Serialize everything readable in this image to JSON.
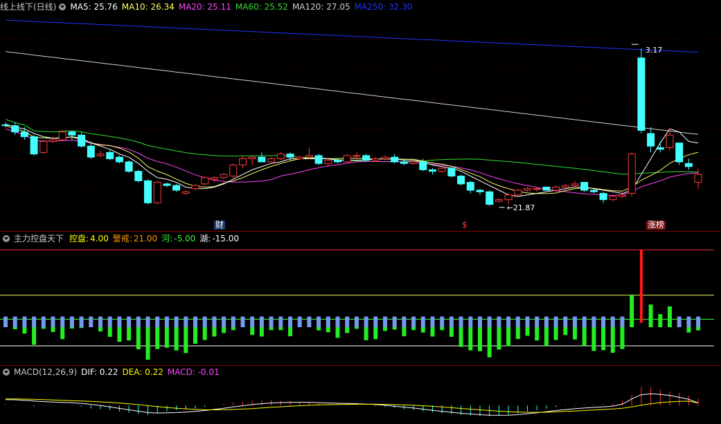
{
  "price_header": {
    "title": "线上线下(日线)",
    "items": [
      {
        "label": "MA5: 25.76",
        "color": "#ffffff"
      },
      {
        "label": "MA10: 26.34",
        "color": "#ffff66"
      },
      {
        "label": "MA20: 25.11",
        "color": "#ff44ff"
      },
      {
        "label": "MA60: 25.52",
        "color": "#33dd33"
      },
      {
        "label": "MA120: 27.05",
        "color": "#d0d0d0"
      },
      {
        "label": "MA250: 32.30",
        "color": "#2233ff"
      }
    ]
  },
  "indicator_header": {
    "title": "主力控盘天下",
    "items": [
      {
        "name": "控盘:",
        "value": "4.00",
        "color": "#ffff00"
      },
      {
        "name": "警戒:",
        "value": "21.00",
        "color": "#ff9900"
      },
      {
        "name": "河:",
        "value": "-5.00",
        "color": "#33ff33"
      },
      {
        "name": "湖:",
        "value": "-15.00",
        "color": "#ffffff"
      }
    ]
  },
  "macd_header": {
    "title": "MACD(12,26,9)",
    "items": [
      {
        "label": "DIF: 0.22",
        "color": "#ffffff"
      },
      {
        "label": "DEA: 0.22",
        "color": "#ffff00"
      },
      {
        "label": "MACD: -0.01",
        "color": "#ff44ff"
      }
    ]
  },
  "markers": {
    "cai": "财",
    "dollar": "$",
    "zhangbang": "涨榜"
  },
  "chart_data": [
    {
      "type": "candlestick",
      "title": "线上线下(日线)",
      "y_range": [
        21.0,
        34.0
      ],
      "annotations": {
        "high": "3.17",
        "low": "21.87"
      },
      "colors": {
        "up": "#ff3b3b",
        "down": "#44ffff"
      },
      "ohlc": [
        [
          26.95,
          27.1,
          26.8,
          26.9
        ],
        [
          26.9,
          27.1,
          26.3,
          26.5
        ],
        [
          26.5,
          26.8,
          26.0,
          26.2
        ],
        [
          26.2,
          26.3,
          25.0,
          25.1
        ],
        [
          25.2,
          26.0,
          25.1,
          25.9
        ],
        [
          25.9,
          26.2,
          25.8,
          26.0
        ],
        [
          26.0,
          26.6,
          25.9,
          26.5
        ],
        [
          26.5,
          26.6,
          26.0,
          26.3
        ],
        [
          26.3,
          26.5,
          25.5,
          25.6
        ],
        [
          25.6,
          25.9,
          24.8,
          24.9
        ],
        [
          25.0,
          25.3,
          24.9,
          25.1
        ],
        [
          25.2,
          25.4,
          24.7,
          24.8
        ],
        [
          24.9,
          25.0,
          24.5,
          24.6
        ],
        [
          24.6,
          24.7,
          23.9,
          24.0
        ],
        [
          24.0,
          24.1,
          23.3,
          23.4
        ],
        [
          23.4,
          23.5,
          21.9,
          22.0
        ],
        [
          22.0,
          23.4,
          21.9,
          23.3
        ],
        [
          23.2,
          23.3,
          23.0,
          23.1
        ],
        [
          23.1,
          23.2,
          22.7,
          22.8
        ],
        [
          22.6,
          22.8,
          22.5,
          22.7
        ],
        [
          22.9,
          23.2,
          22.8,
          23.1
        ],
        [
          23.2,
          23.7,
          23.1,
          23.6
        ],
        [
          23.5,
          23.7,
          23.3,
          23.6
        ],
        [
          23.6,
          23.9,
          23.5,
          23.8
        ],
        [
          23.7,
          24.5,
          23.5,
          24.4
        ],
        [
          24.4,
          25.0,
          24.2,
          24.8
        ],
        [
          24.8,
          25.0,
          24.4,
          24.9
        ],
        [
          24.9,
          25.2,
          24.6,
          24.6
        ],
        [
          24.6,
          24.9,
          24.5,
          24.8
        ],
        [
          24.8,
          25.2,
          24.7,
          25.1
        ],
        [
          25.1,
          25.2,
          24.7,
          24.9
        ],
        [
          24.8,
          25.0,
          24.7,
          24.9
        ],
        [
          24.9,
          25.5,
          24.8,
          25.0
        ],
        [
          25.0,
          25.1,
          24.4,
          24.5
        ],
        [
          24.5,
          24.8,
          24.3,
          24.7
        ],
        [
          24.7,
          24.8,
          24.5,
          24.6
        ],
        [
          24.6,
          25.1,
          24.5,
          25.0
        ],
        [
          25.0,
          25.2,
          24.8,
          25.0
        ],
        [
          25.0,
          25.1,
          24.6,
          24.7
        ],
        [
          24.7,
          24.9,
          24.6,
          24.8
        ],
        [
          24.8,
          25.0,
          24.7,
          24.9
        ],
        [
          24.9,
          25.1,
          24.5,
          24.6
        ],
        [
          24.6,
          24.8,
          24.4,
          24.5
        ],
        [
          24.5,
          24.7,
          24.4,
          24.6
        ],
        [
          24.6,
          24.8,
          24.0,
          24.1
        ],
        [
          24.1,
          24.2,
          23.8,
          24.0
        ],
        [
          24.0,
          24.3,
          23.9,
          24.2
        ],
        [
          24.2,
          24.3,
          23.6,
          23.7
        ],
        [
          23.7,
          23.8,
          23.1,
          23.2
        ],
        [
          23.3,
          23.4,
          22.6,
          22.8
        ],
        [
          22.8,
          22.9,
          22.5,
          22.7
        ],
        [
          22.7,
          22.8,
          21.8,
          21.9
        ],
        [
          22.1,
          22.3,
          22.0,
          22.2
        ],
        [
          22.2,
          22.6,
          21.9,
          22.5
        ],
        [
          22.5,
          22.9,
          22.4,
          22.8
        ],
        [
          22.8,
          23.0,
          22.7,
          22.9
        ],
        [
          22.9,
          23.0,
          22.7,
          22.9
        ],
        [
          23.0,
          23.0,
          22.8,
          22.8
        ],
        [
          22.8,
          23.1,
          22.7,
          23.0
        ],
        [
          23.0,
          23.2,
          22.8,
          23.1
        ],
        [
          23.1,
          23.4,
          23.0,
          23.2
        ],
        [
          23.3,
          23.3,
          22.7,
          22.8
        ],
        [
          22.8,
          22.9,
          22.6,
          22.7
        ],
        [
          22.6,
          22.7,
          22.0,
          22.2
        ],
        [
          22.2,
          22.5,
          22.1,
          22.4
        ],
        [
          22.4,
          22.6,
          22.3,
          22.5
        ],
        [
          22.6,
          25.2,
          22.4,
          25.1
        ],
        [
          31.2,
          31.8,
          26.4,
          26.6
        ],
        [
          26.4,
          26.8,
          25.2,
          25.6
        ],
        [
          25.5,
          25.9,
          25.2,
          25.4
        ],
        [
          25.5,
          26.7,
          25.3,
          26.3
        ],
        [
          25.8,
          25.8,
          24.4,
          24.6
        ],
        [
          24.5,
          24.8,
          24.1,
          24.3
        ],
        [
          23.3,
          24.2,
          22.9,
          23.8
        ]
      ],
      "ma": {
        "MA5": [
          27.0,
          26.8,
          26.7,
          26.4,
          26.2,
          26.1,
          26.1,
          26.2,
          26.1,
          25.8,
          25.6,
          25.4,
          25.1,
          24.9,
          24.5,
          24.0,
          23.6,
          23.5,
          23.3,
          23.0,
          22.9,
          22.9,
          23.0,
          23.2,
          23.5,
          23.8,
          24.1,
          24.3,
          24.5,
          24.6,
          24.8,
          24.8,
          24.8,
          24.8,
          24.8,
          24.7,
          24.7,
          24.7,
          24.7,
          24.8,
          24.8,
          24.8,
          24.7,
          24.7,
          24.6,
          24.4,
          24.3,
          24.2,
          24.0,
          23.7,
          23.4,
          23.1,
          22.8,
          22.5,
          22.4,
          22.5,
          22.6,
          22.7,
          22.8,
          22.9,
          23.0,
          23.0,
          22.9,
          22.8,
          22.7,
          22.6,
          22.8,
          23.8,
          24.8,
          25.8,
          26.7,
          26.5,
          25.9,
          25.8
        ]
      }
    },
    {
      "type": "bar",
      "title": "主力控盘天下",
      "y_range": [
        -22.0,
        26.0
      ],
      "levels": {
        "控盘": 4.0,
        "警戒": 21.0,
        "河": -5.0,
        "湖": -15.0
      },
      "top_values": [
        -4.0,
        -4.0,
        -4.0,
        -4.0,
        -4.0,
        -4.0,
        -4.0,
        -4.0,
        -4.0,
        -4.0,
        -4.0,
        -4.0,
        -4.0,
        -4.0,
        -4.0,
        -4.0,
        -4.0,
        -4.0,
        -4.0,
        -4.0,
        -4.0,
        -4.0,
        -4.0,
        -4.0,
        -4.0,
        -4.0,
        -4.0,
        -4.0,
        -4.0,
        -4.0,
        -4.0,
        -4.0,
        -4.0,
        -4.0,
        -4.0,
        -4.0,
        -4.0,
        -4.0,
        -4.0,
        -4.0,
        -4.0,
        -4.0,
        -4.0,
        -4.0,
        -4.0,
        -4.0,
        -4.0,
        -4.0,
        -4.0,
        -4.0,
        -4.0,
        -4.0,
        -4.0,
        -4.0,
        -4.0,
        -4.0,
        -4.0,
        -4.0,
        -4.0,
        -4.0,
        -4.0,
        -4.0,
        -4.0,
        -4.0,
        -4.0,
        -4.0,
        -4.0,
        -4.0,
        -4.0,
        -4.0,
        -4.0,
        -4.0,
        -4.0,
        -4.0
      ],
      "values": [
        -7.5,
        -8.8,
        -10.4,
        -14.6,
        -8.6,
        -9.8,
        -12.5,
        -8.5,
        -8.3,
        -7.7,
        -9.6,
        -11.6,
        -13.5,
        -13.0,
        -16.3,
        -20.2,
        -16.2,
        -15.7,
        -16.7,
        -17.7,
        -14.2,
        -12.8,
        -11.5,
        -10.2,
        -9.1,
        -8.0,
        -10.9,
        -11.5,
        -9.1,
        -9.1,
        -11.4,
        -7.3,
        -6.8,
        -9.2,
        -9.9,
        -12.0,
        -10.2,
        -8.6,
        -12.9,
        -12.5,
        -9.4,
        -8.9,
        -11.4,
        -9.1,
        -10.0,
        -11.5,
        -9.1,
        -11.6,
        -15.4,
        -16.7,
        -17.0,
        -19.3,
        -16.4,
        -15.1,
        -12.4,
        -11.2,
        -13.0,
        -15.0,
        -12.8,
        -10.9,
        -12.6,
        -15.0,
        -16.9,
        -16.6,
        -17.6,
        -16.2,
        4.0,
        21.0,
        0.5,
        -3.1,
        -0.2,
        -6.0,
        -10.0,
        -9.2
      ]
    },
    {
      "type": "bar",
      "title": "MACD(12,26,9)",
      "y_range": [
        -1.5,
        2.5
      ],
      "values": [
        0.08,
        0.06,
        -0.02,
        -0.08,
        -0.06,
        -0.04,
        0.02,
        -0.04,
        -0.1,
        -0.26,
        -0.32,
        -0.42,
        -0.52,
        -0.62,
        -0.72,
        -0.82,
        -0.62,
        -0.5,
        -0.42,
        -0.34,
        -0.26,
        -0.14,
        0.06,
        0.12,
        0.26,
        0.34,
        0.42,
        0.48,
        0.48,
        0.42,
        0.4,
        0.34,
        0.32,
        0.18,
        0.12,
        0.06,
        0.08,
        0.08,
        -0.02,
        -0.06,
        -0.14,
        -0.22,
        -0.32,
        -0.38,
        -0.5,
        -0.58,
        -0.68,
        -0.74,
        -0.82,
        -0.86,
        -0.92,
        -0.94,
        -0.88,
        -0.8,
        -0.68,
        -0.52,
        -0.42,
        -0.28,
        -0.14,
        -0.04,
        0.06,
        0.08,
        0.1,
        0.12,
        0.18,
        0.42,
        0.92,
        1.62,
        1.6,
        1.42,
        1.24,
        1.1,
        0.86,
        0.6
      ],
      "series": [
        {
          "name": "DIF",
          "values": [
            0.52,
            0.5,
            0.45,
            0.4,
            0.34,
            0.3,
            0.27,
            0.24,
            0.18,
            0.1,
            0.0,
            -0.12,
            -0.25,
            -0.38,
            -0.5,
            -0.62,
            -0.66,
            -0.64,
            -0.62,
            -0.58,
            -0.52,
            -0.44,
            -0.34,
            -0.24,
            -0.12,
            -0.02,
            0.08,
            0.16,
            0.22,
            0.25,
            0.28,
            0.28,
            0.28,
            0.25,
            0.22,
            0.2,
            0.18,
            0.16,
            0.12,
            0.08,
            0.02,
            -0.06,
            -0.14,
            -0.22,
            -0.32,
            -0.42,
            -0.52,
            -0.6,
            -0.68,
            -0.74,
            -0.8,
            -0.85,
            -0.86,
            -0.85,
            -0.8,
            -0.72,
            -0.64,
            -0.54,
            -0.44,
            -0.36,
            -0.28,
            -0.22,
            -0.16,
            -0.12,
            -0.05,
            0.12,
            0.58,
            0.95,
            1.02,
            0.98,
            0.88,
            0.72,
            0.55,
            0.22
          ]
        },
        {
          "name": "DEA",
          "values": [
            0.58,
            0.57,
            0.56,
            0.54,
            0.52,
            0.49,
            0.46,
            0.43,
            0.4,
            0.36,
            0.32,
            0.27,
            0.21,
            0.15,
            0.07,
            -0.01,
            -0.1,
            -0.17,
            -0.24,
            -0.29,
            -0.34,
            -0.37,
            -0.38,
            -0.37,
            -0.35,
            -0.31,
            -0.27,
            -0.21,
            -0.16,
            -0.11,
            -0.06,
            -0.02,
            0.02,
            0.05,
            0.07,
            0.09,
            0.1,
            0.11,
            0.11,
            0.11,
            0.1,
            0.08,
            0.05,
            0.02,
            -0.02,
            -0.07,
            -0.13,
            -0.19,
            -0.26,
            -0.32,
            -0.38,
            -0.44,
            -0.5,
            -0.54,
            -0.58,
            -0.6,
            -0.6,
            -0.59,
            -0.56,
            -0.52,
            -0.48,
            -0.44,
            -0.4,
            -0.35,
            -0.3,
            -0.24,
            -0.12,
            0.02,
            0.15,
            0.25,
            0.32,
            0.36,
            0.38,
            0.22
          ]
        }
      ]
    }
  ]
}
